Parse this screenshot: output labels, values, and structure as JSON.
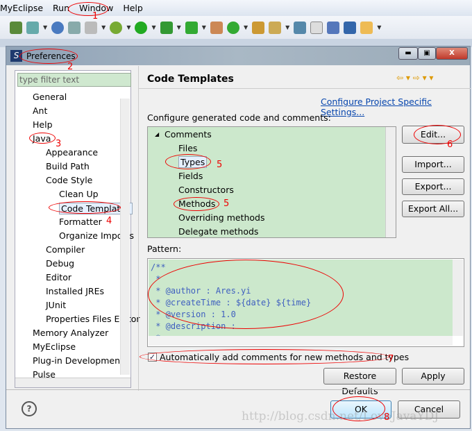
{
  "menu": [
    "MyEclipse",
    "Run",
    "Window",
    "Help"
  ],
  "dialog": {
    "title": "Preferences"
  },
  "filter": {
    "placeholder": "type filter text"
  },
  "tree": [
    {
      "label": "General",
      "level": 0
    },
    {
      "label": "Ant",
      "level": 0
    },
    {
      "label": "Help",
      "level": 0
    },
    {
      "label": "Java",
      "level": 0
    },
    {
      "label": "Appearance",
      "level": 1
    },
    {
      "label": "Build Path",
      "level": 1
    },
    {
      "label": "Code Style",
      "level": 1
    },
    {
      "label": "Clean Up",
      "level": 2
    },
    {
      "label": "Code Templates",
      "level": 2,
      "selected": true
    },
    {
      "label": "Formatter",
      "level": 2
    },
    {
      "label": "Organize Imports",
      "level": 2
    },
    {
      "label": "Compiler",
      "level": 1
    },
    {
      "label": "Debug",
      "level": 1
    },
    {
      "label": "Editor",
      "level": 1
    },
    {
      "label": "Installed JREs",
      "level": 1
    },
    {
      "label": "JUnit",
      "level": 1
    },
    {
      "label": "Properties Files Editor",
      "level": 1
    },
    {
      "label": "Memory Analyzer",
      "level": 0
    },
    {
      "label": "MyEclipse",
      "level": 0
    },
    {
      "label": "Plug-in Development",
      "level": 0
    },
    {
      "label": "Pulse",
      "level": 0
    }
  ],
  "page": {
    "title": "Code Templates",
    "link": "Configure Project Specific Settings...",
    "configure_label": "Configure generated code and comments:",
    "templates": [
      "Comments",
      "Files",
      "Types",
      "Fields",
      "Constructors",
      "Methods",
      "Overriding methods",
      "Delegate methods"
    ],
    "buttons": {
      "edit": "Edit...",
      "import": "Import...",
      "export": "Export...",
      "export_all": "Export All..."
    },
    "pattern_label": "Pattern:",
    "pattern": "/**\n *\n * @author : Ares.yi\n * @createTime : ${date} ${time}\n * @version : 1.0\n * @description :\n *",
    "auto_comment": "Automatically add comments for new methods and types",
    "auto_comment_checked": true,
    "restore": "Restore Defaults",
    "apply": "Apply"
  },
  "footer": {
    "ok": "OK",
    "cancel": "Cancel"
  },
  "annotations": [
    "1",
    "2",
    "3",
    "4",
    "5",
    "5",
    "6",
    "7",
    "8"
  ],
  "watermark": "http://blog.csdn.net/LoveJavaYDJ"
}
